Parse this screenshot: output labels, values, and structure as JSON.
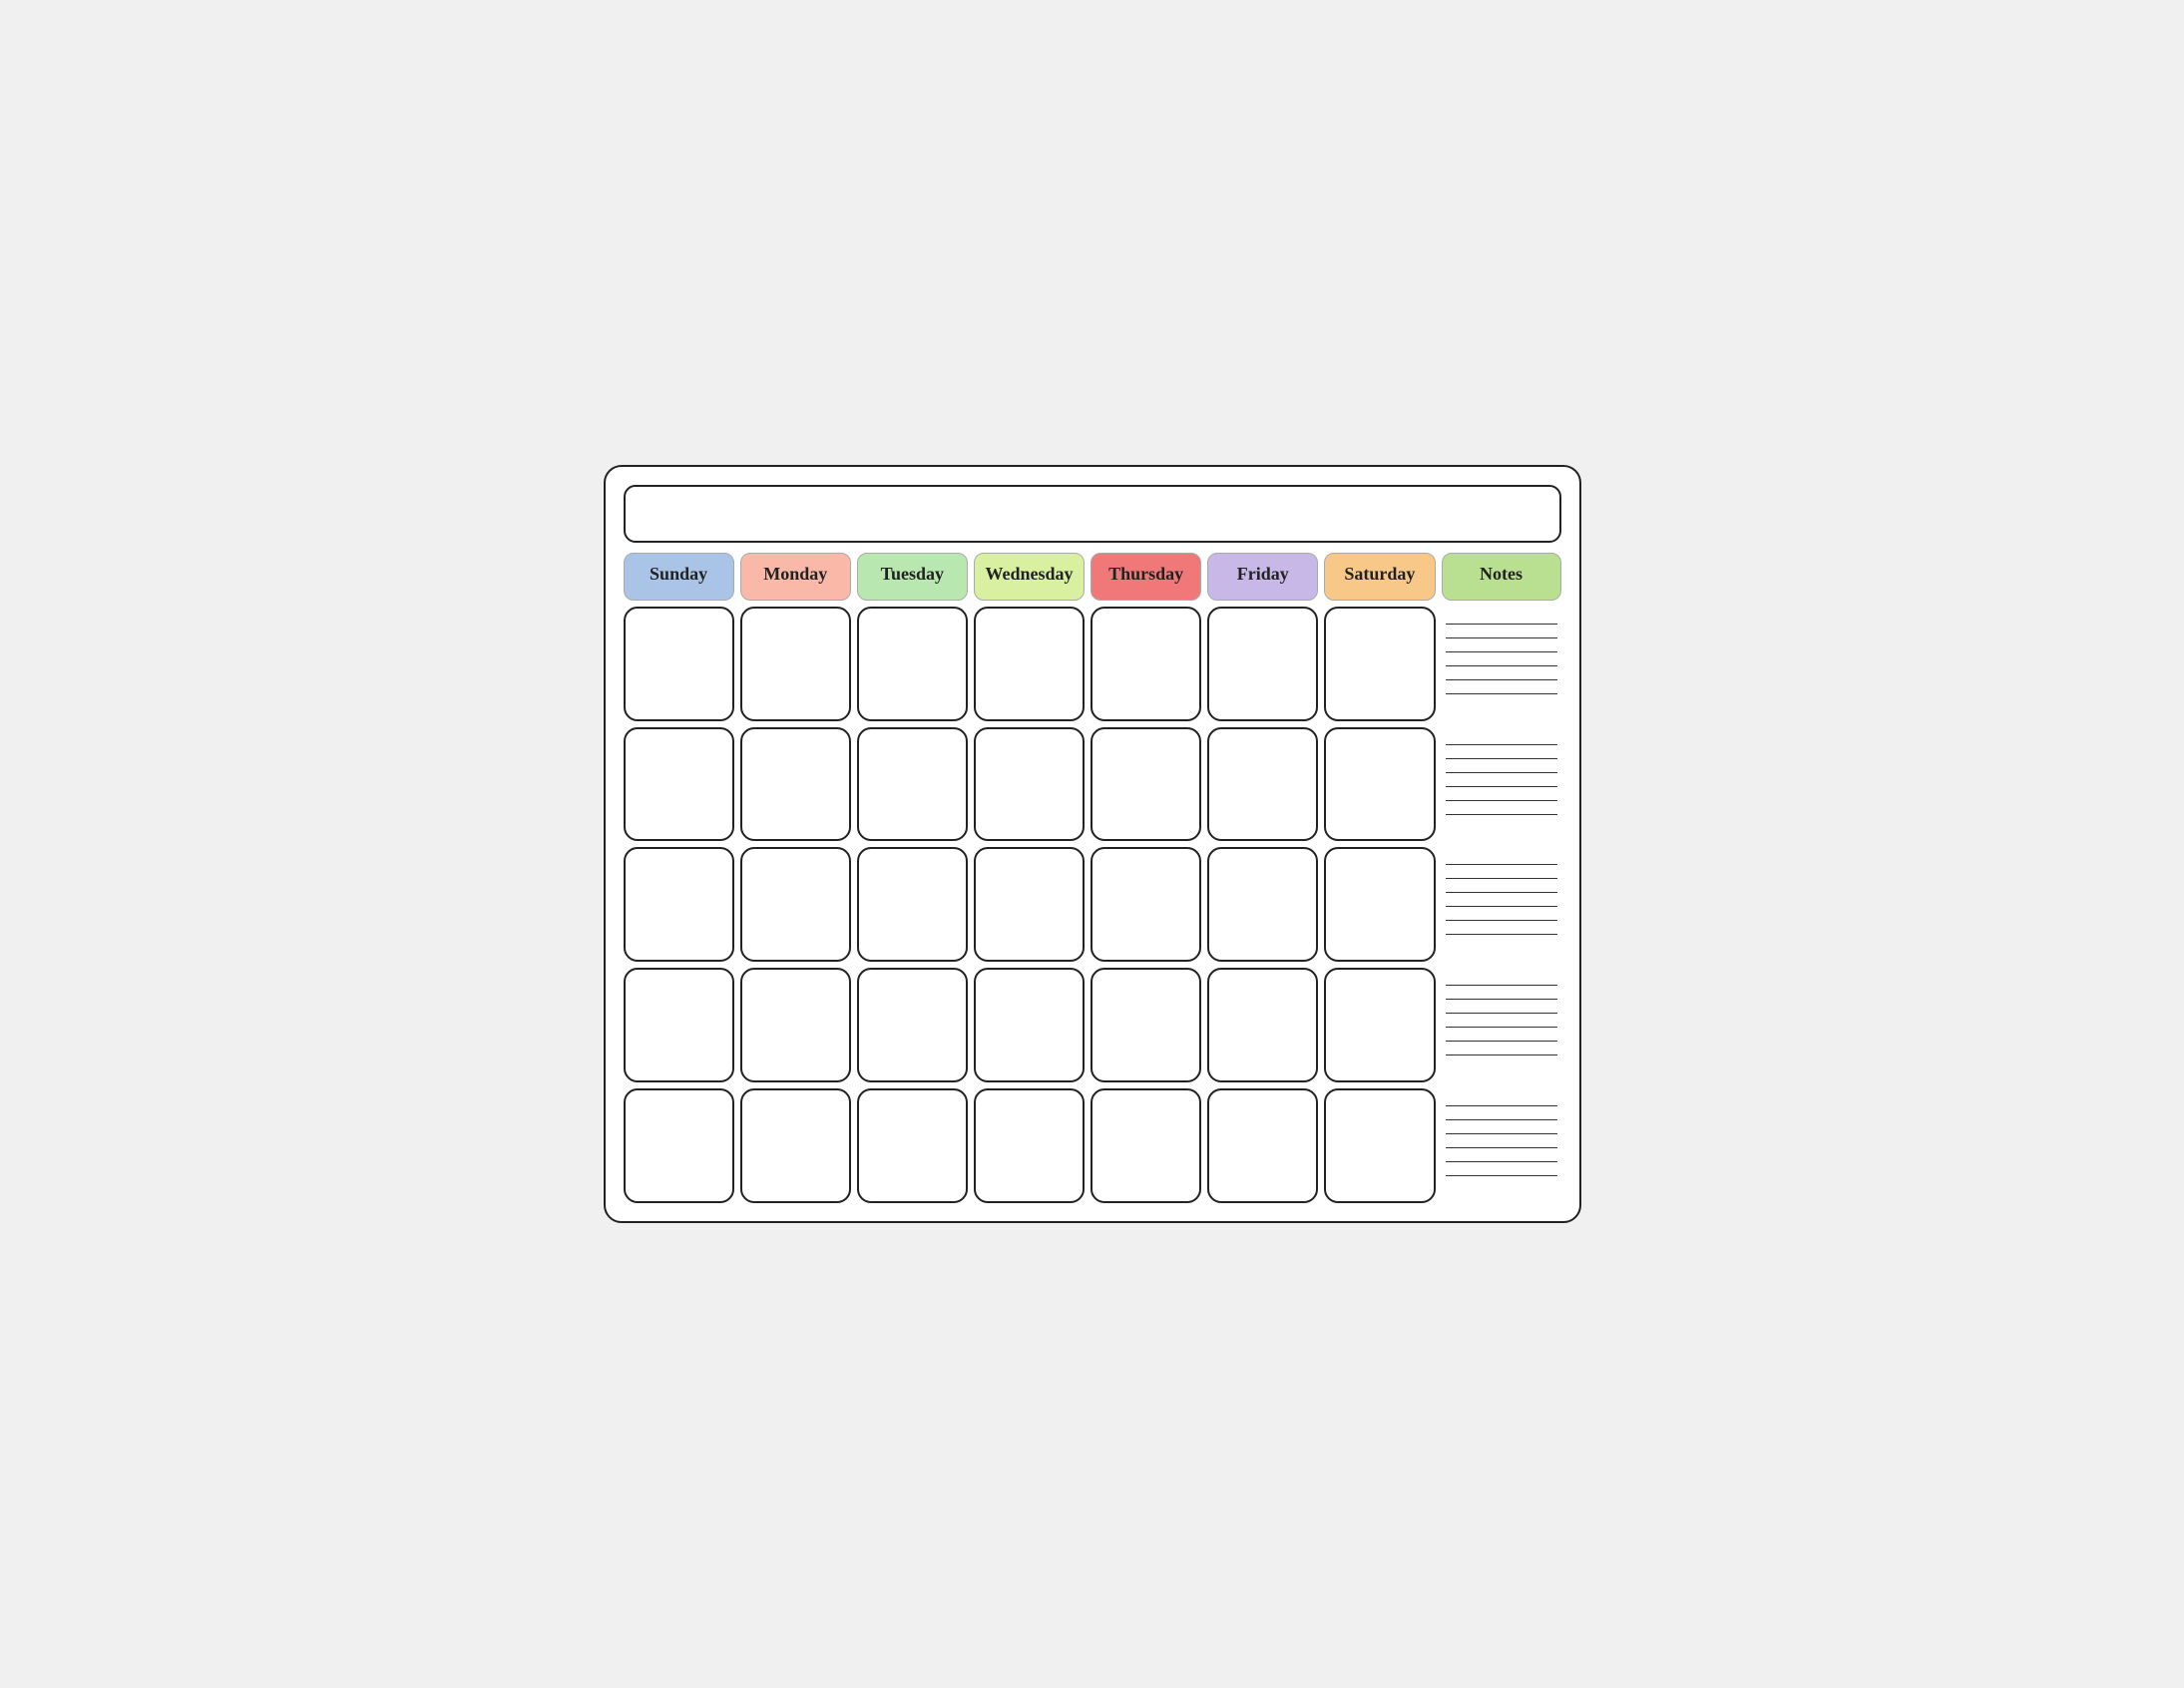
{
  "header": {
    "title": ""
  },
  "days": [
    {
      "label": "Sunday",
      "colorClass": "sunday-header"
    },
    {
      "label": "Monday",
      "colorClass": "monday-header"
    },
    {
      "label": "Tuesday",
      "colorClass": "tuesday-header"
    },
    {
      "label": "Wednesday",
      "colorClass": "wednesday-header"
    },
    {
      "label": "Thursday",
      "colorClass": "thursday-header"
    },
    {
      "label": "Friday",
      "colorClass": "friday-header"
    },
    {
      "label": "Saturday",
      "colorClass": "saturday-header"
    }
  ],
  "notes_label": "Notes",
  "rows": 5,
  "note_lines": 30
}
